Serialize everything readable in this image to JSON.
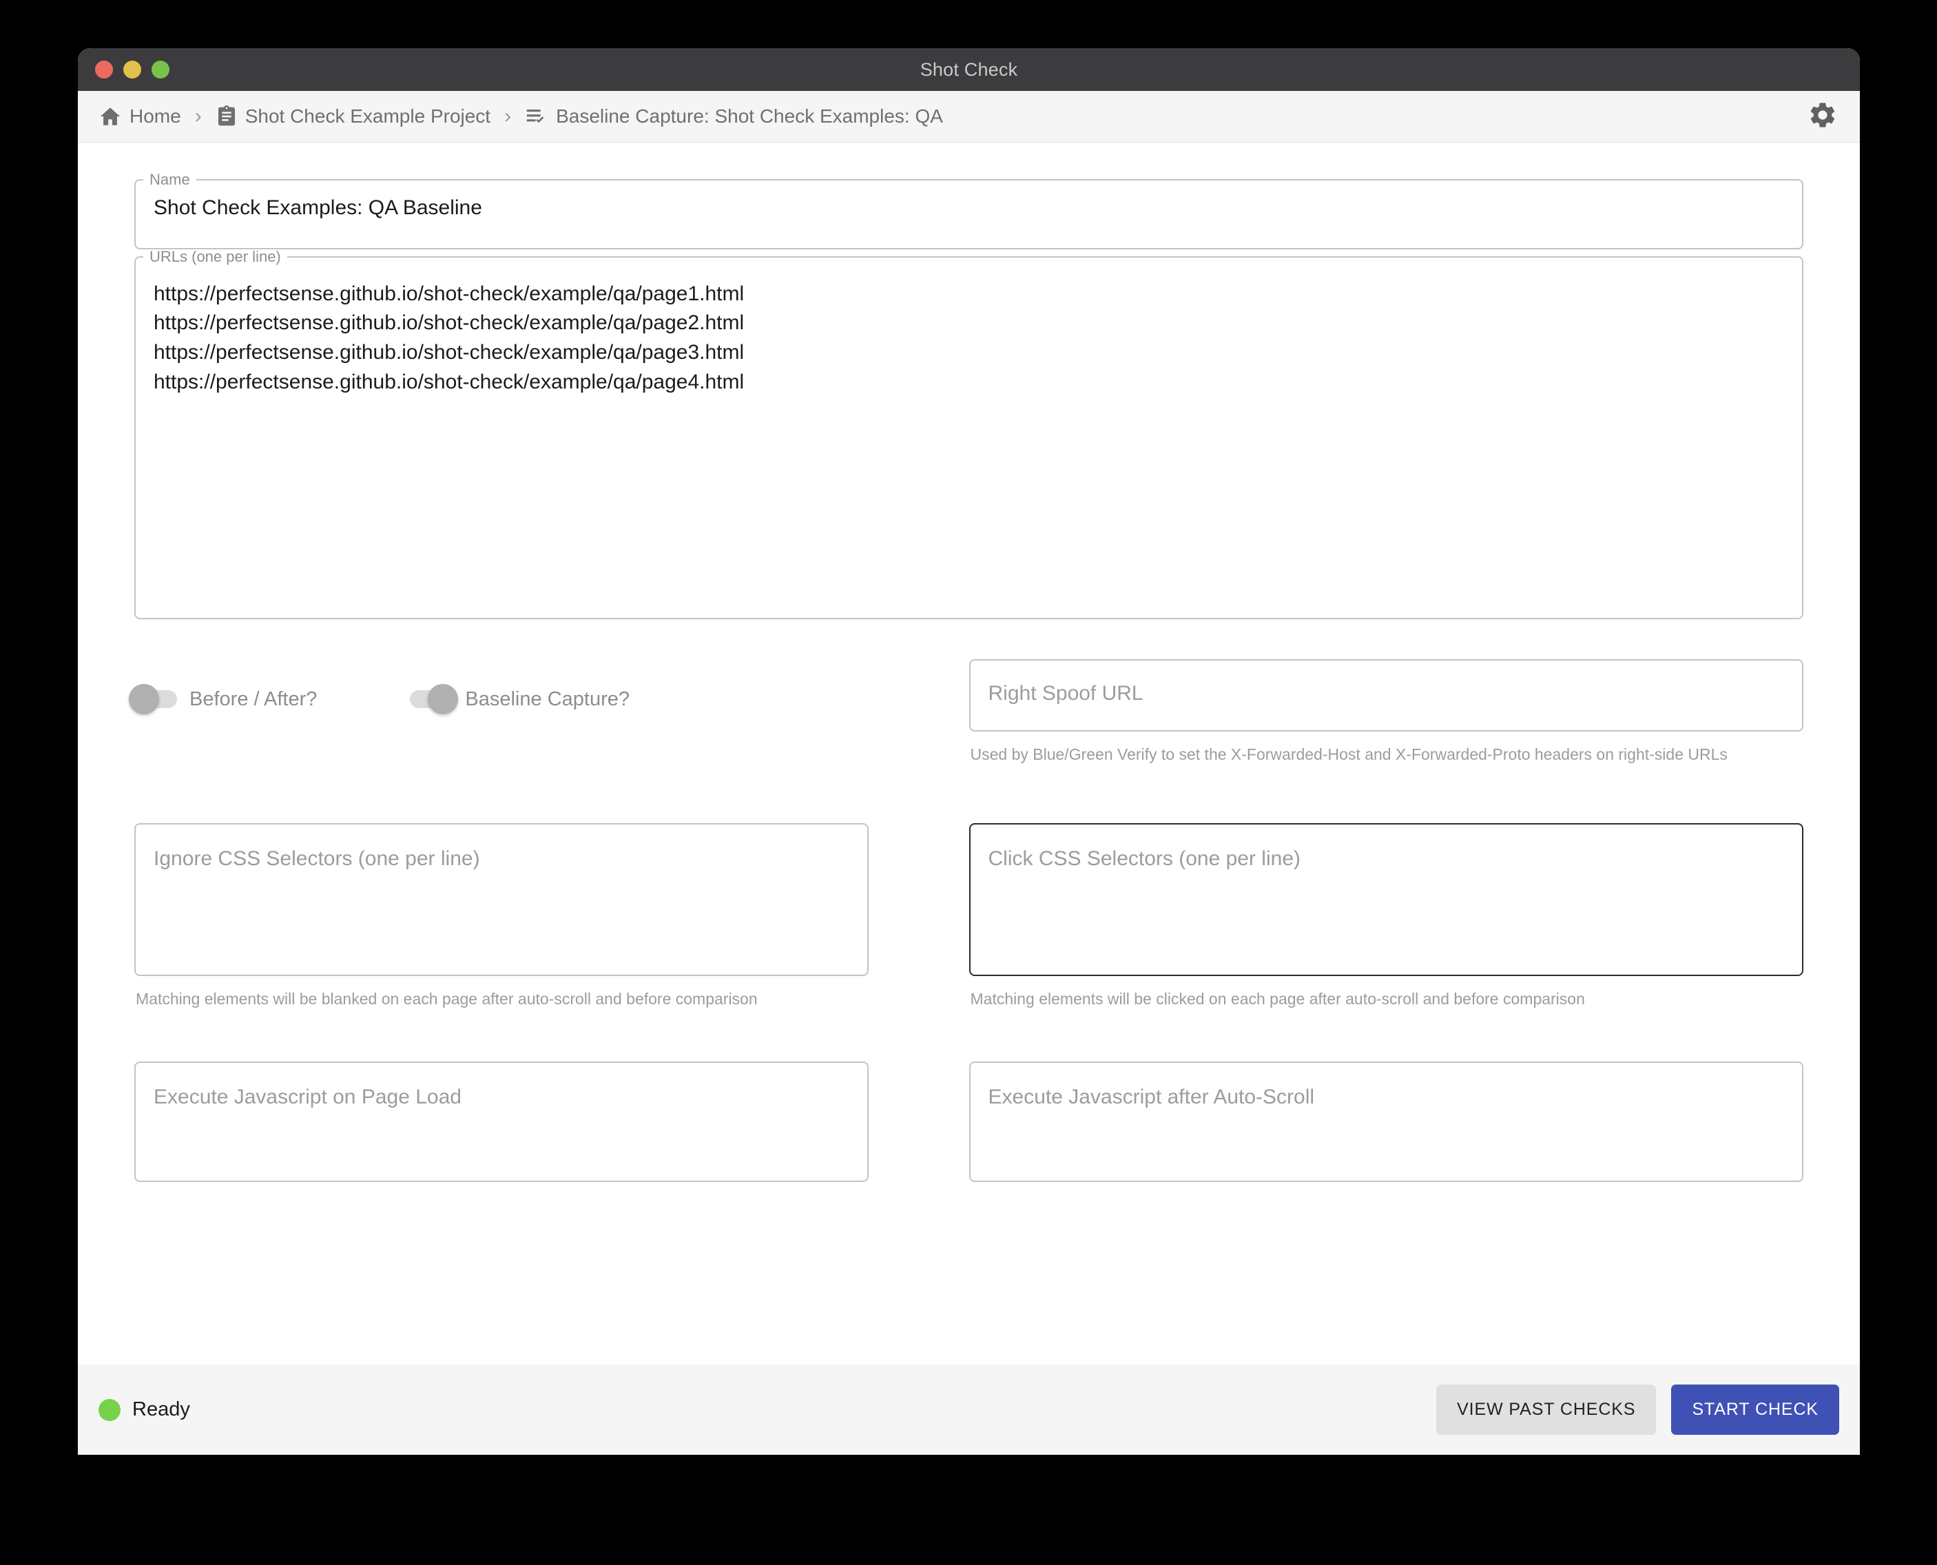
{
  "window": {
    "title": "Shot Check",
    "traffic_lights": [
      "close-red",
      "minimize-yellow",
      "zoom-green"
    ]
  },
  "toolbar": {
    "breadcrumb": [
      {
        "icon": "home-icon",
        "label": "Home"
      },
      {
        "icon": "clipboard-icon",
        "label": "Shot Check Example Project"
      },
      {
        "icon": "playlist-check-icon",
        "label": "Baseline Capture: Shot Check Examples: QA"
      }
    ],
    "separator": "›",
    "settings_icon": "gear-icon"
  },
  "form": {
    "name": {
      "legend": "Name",
      "value": "Shot Check Examples: QA Baseline"
    },
    "urls": {
      "legend": "URLs (one per line)",
      "value": "https://perfectsense.github.io/shot-check/example/qa/page1.html\nhttps://perfectsense.github.io/shot-check/example/qa/page2.html\nhttps://perfectsense.github.io/shot-check/example/qa/page3.html\nhttps://perfectsense.github.io/shot-check/example/qa/page4.html"
    },
    "toggles": [
      {
        "label": "Before / After?",
        "state": "off"
      },
      {
        "label": "Baseline Capture?",
        "state": "on"
      }
    ],
    "right_spoof_url": {
      "placeholder": "Right Spoof URL",
      "value": "",
      "helper": "Used by Blue/Green Verify to set the X-Forwarded-Host and X-Forwarded-Proto headers on right-side URLs"
    },
    "ignore_css_selectors": {
      "placeholder": "Ignore CSS Selectors (one per line)",
      "value": "",
      "helper": "Matching elements will be blanked on each page after auto-scroll and before comparison"
    },
    "click_css_selectors": {
      "placeholder": "Click CSS Selectors (one per line)",
      "value": "",
      "helper": "Matching elements will be clicked on each page after auto-scroll and before comparison",
      "focused": true
    },
    "execute_js_page_load": {
      "placeholder": "Execute Javascript on Page Load",
      "value": ""
    },
    "execute_js_after_scroll": {
      "placeholder": "Execute Javascript after Auto-Scroll",
      "value": ""
    }
  },
  "statusbar": {
    "status_text": "Ready",
    "status_color": "#76d24a",
    "view_past_checks_label": "VIEW PAST CHECKS",
    "start_check_label": "START CHECK",
    "primary_color": "#3f51b5"
  }
}
